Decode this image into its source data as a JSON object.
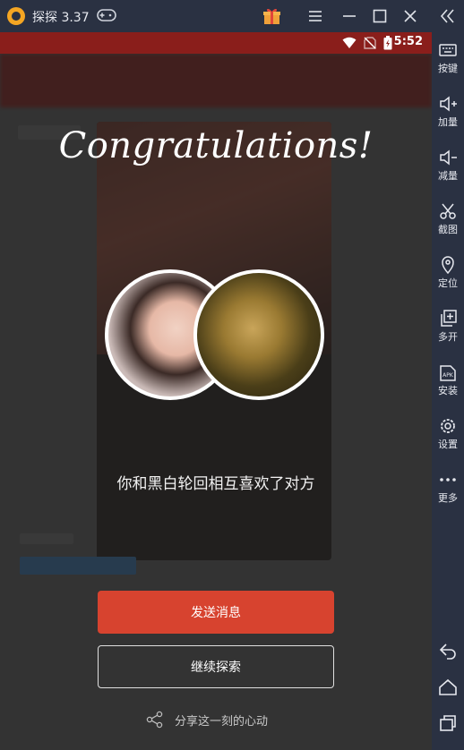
{
  "window": {
    "title": "探探 3.37",
    "controls": [
      "gift-icon",
      "menu-icon",
      "minimize-icon",
      "maximize-icon",
      "close-icon"
    ]
  },
  "status_bar": {
    "time": "5:52",
    "icons": [
      "wifi-icon",
      "no-sim-icon",
      "battery-charging-icon"
    ]
  },
  "match_dialog": {
    "headline": "Congratulations!",
    "message": "你和黑白轮回相互喜欢了对方",
    "primary_button": "发送消息",
    "secondary_button": "继续探索",
    "share_label": "分享这一刻的心动"
  },
  "sidebar": {
    "collapse_icon": "double-chevron-left-icon",
    "items": [
      {
        "label": "按键",
        "icon": "keyboard-icon"
      },
      {
        "label": "加量",
        "icon": "volume-up-icon"
      },
      {
        "label": "减量",
        "icon": "volume-down-icon"
      },
      {
        "label": "截图",
        "icon": "scissors-icon"
      },
      {
        "label": "定位",
        "icon": "location-pin-icon"
      },
      {
        "label": "多开",
        "icon": "multi-instance-icon"
      },
      {
        "label": "安装",
        "icon": "apk-install-icon"
      },
      {
        "label": "设置",
        "icon": "gear-icon"
      },
      {
        "label": "更多",
        "icon": "more-dots-icon"
      }
    ],
    "nav": [
      "back-icon",
      "home-icon",
      "recent-apps-icon"
    ]
  },
  "colors": {
    "primary_button": "#d7432f",
    "chrome": "#2a3142",
    "app_bar": "#8a1e1b"
  }
}
